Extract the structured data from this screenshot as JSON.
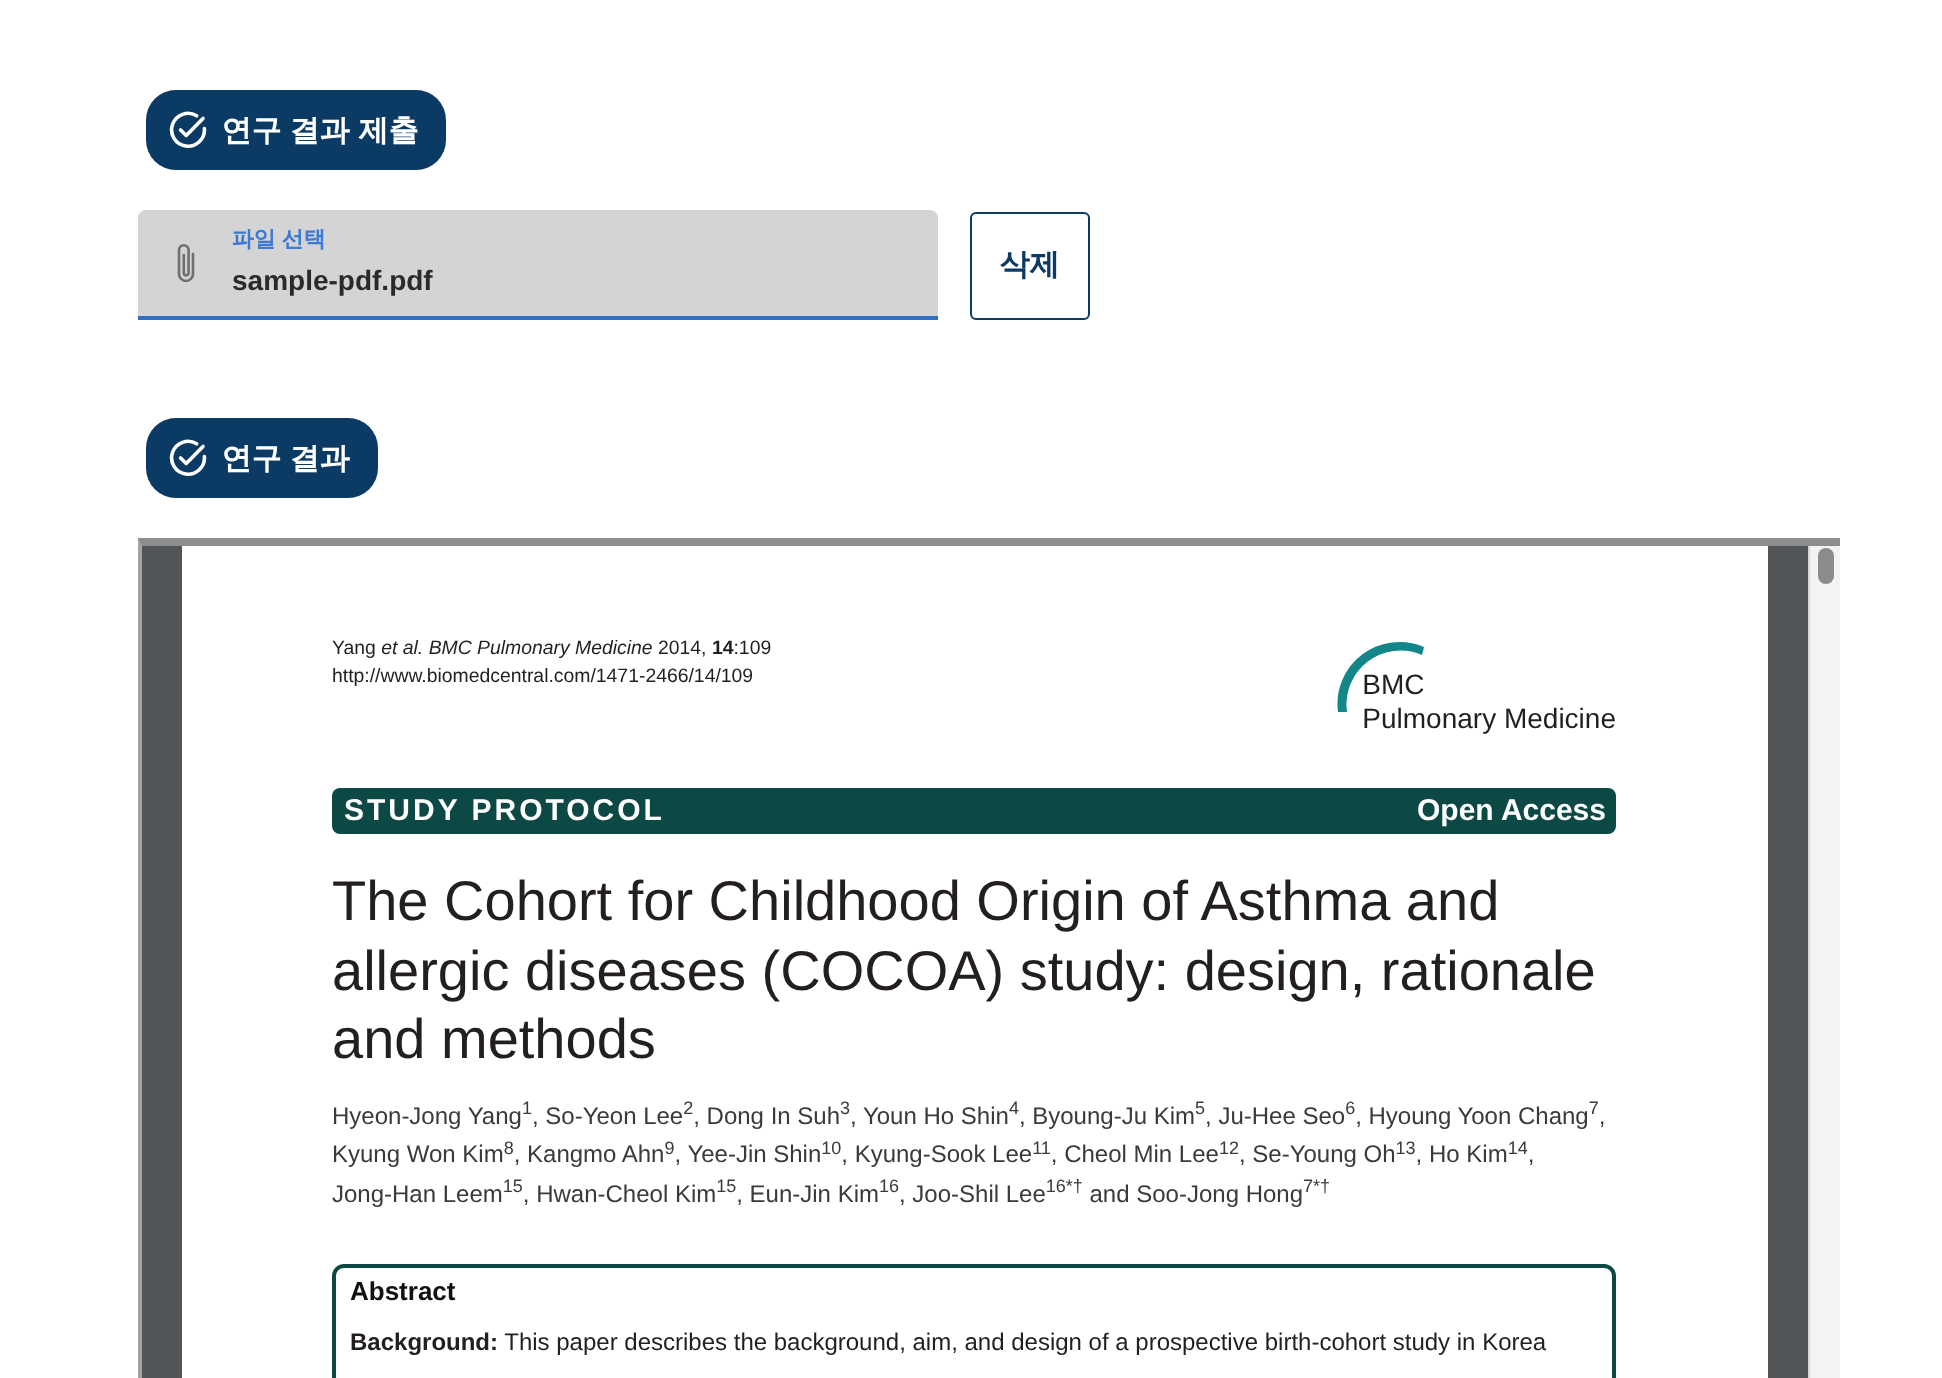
{
  "submission": {
    "badge": "연구 결과 제출",
    "file_field": {
      "label": "파일 선택",
      "value": "sample-pdf.pdf",
      "focused": true
    },
    "delete_button": "삭제"
  },
  "result": {
    "badge": "연구 결과",
    "pdf_page": {
      "citation": "Yang *et al.* *BMC Pulmonary Medicine* 2014, **14**:109",
      "url": "http://www.biomedcentral.com/1471-2466/14/109",
      "journal_logo": {
        "line_1": "BMC",
        "line_2": "Pulmonary Medicine"
      },
      "article_type": "STUDY PROTOCOL",
      "access": "Open Access",
      "title": "The Cohort for Childhood Origin of Asthma and allergic diseases (COCOA) study: design, rationale and methods",
      "authors": [
        {
          "name": "Hyeon-Jong Yang",
          "affiliation": "1",
          "separator": ", "
        },
        {
          "name": "So-Yeon Lee",
          "affiliation": "2",
          "separator": ", "
        },
        {
          "name": "Dong In Suh",
          "affiliation": "3",
          "separator": ", "
        },
        {
          "name": "Youn Ho Shin",
          "affiliation": "4",
          "separator": ", "
        },
        {
          "name": "Byoung-Ju Kim",
          "affiliation": "5",
          "separator": ", "
        },
        {
          "name": "Ju-Hee Seo",
          "affiliation": "6",
          "separator": ", "
        },
        {
          "name": "Hyoung Yoon Chang",
          "affiliation": "7",
          "separator": ", "
        },
        {
          "name": "Kyung Won Kim",
          "affiliation": "8",
          "separator": ", "
        },
        {
          "name": "Kangmo Ahn",
          "affiliation": "9",
          "separator": ", "
        },
        {
          "name": "Yee-Jin Shin",
          "affiliation": "10",
          "separator": ", "
        },
        {
          "name": "Kyung-Sook Lee",
          "affiliation": "11",
          "separator": ", "
        },
        {
          "name": "Cheol Min Lee",
          "affiliation": "12",
          "separator": ", "
        },
        {
          "name": "Se-Young Oh",
          "affiliation": "13",
          "separator": ", "
        },
        {
          "name": "Ho Kim",
          "affiliation": "14",
          "separator": ", "
        },
        {
          "name": "Jong-Han Leem",
          "affiliation": "15",
          "separator": ", "
        },
        {
          "name": "Hwan-Cheol Kim",
          "affiliation": "15",
          "separator": ", "
        },
        {
          "name": "Eun-Jin Kim",
          "affiliation": "16",
          "separator": ", "
        },
        {
          "name": "Joo-Shil Lee",
          "affiliation": "16*†",
          "separator": " and "
        },
        {
          "name": "Soo-Jong Hong",
          "affiliation": "7*†"
        }
      ],
      "abstract": {
        "heading": "Abstract",
        "text": "**Background:** This paper describes the background, aim, and design of a prospective birth-cohort study in Korea"
      }
    }
  }
}
